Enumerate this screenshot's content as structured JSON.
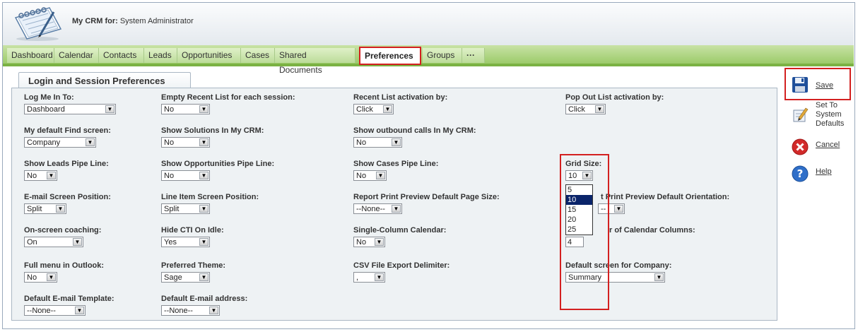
{
  "header": {
    "title_bold": "My CRM for:",
    "title_user": "System Administrator"
  },
  "tabs": [
    {
      "label": "Dashboard"
    },
    {
      "label": "Calendar"
    },
    {
      "label": "Contacts"
    },
    {
      "label": "Leads"
    },
    {
      "label": "Opportunities"
    },
    {
      "label": "Cases"
    },
    {
      "label": "Shared Documents"
    },
    {
      "label": "Preferences"
    },
    {
      "label": "Groups"
    },
    {
      "label": "···"
    }
  ],
  "section": {
    "title": "Login and Session Preferences"
  },
  "fields": {
    "log_me_in_to": {
      "label": "Log Me In To:",
      "value": "Dashboard"
    },
    "empty_recent": {
      "label": "Empty Recent List for each session:",
      "value": "No"
    },
    "recent_activation": {
      "label": "Recent List activation by:",
      "value": "Click"
    },
    "popout_activation": {
      "label": "Pop Out List activation by:",
      "value": "Click"
    },
    "default_find": {
      "label": "My default Find screen:",
      "value": "Company"
    },
    "show_solutions": {
      "label": "Show Solutions In My CRM:",
      "value": "No"
    },
    "show_outbound": {
      "label": "Show outbound calls In My CRM:",
      "value": "No"
    },
    "leads_pipe": {
      "label": "Show Leads Pipe Line:",
      "value": "No"
    },
    "opps_pipe": {
      "label": "Show Opportunities Pipe Line:",
      "value": "No"
    },
    "cases_pipe": {
      "label": "Show Cases Pipe Line:",
      "value": "No"
    },
    "grid_size": {
      "label": "Grid Size:",
      "value": "10"
    },
    "email_screen_pos": {
      "label": "E-mail Screen Position:",
      "value": "Split"
    },
    "line_item_pos": {
      "label": "Line Item Screen Position:",
      "value": "Split"
    },
    "report_page_size": {
      "label": "Report Print Preview Default Page Size:",
      "value": "--None--"
    },
    "report_orientation": {
      "label": "t Print Preview Default Orientation:",
      "value": "--"
    },
    "onscreen_coaching": {
      "label": "On-screen coaching:",
      "value": "On"
    },
    "hide_cti": {
      "label": "Hide CTI On Idle:",
      "value": "Yes"
    },
    "single_col_cal": {
      "label": "Single-Column Calendar:",
      "value": "No"
    },
    "num_cal_cols": {
      "label": "r of Calendar Columns:",
      "value": "4"
    },
    "full_menu_outlook": {
      "label": "Full menu in Outlook:",
      "value": "No"
    },
    "preferred_theme": {
      "label": "Preferred Theme:",
      "value": "Sage"
    },
    "csv_delimiter": {
      "label": "CSV File Export Delimiter:",
      "value": ","
    },
    "default_company_screen": {
      "label": "Default screen for Company:",
      "value": "Summary"
    },
    "default_email_template": {
      "label": "Default E-mail Template:",
      "value": "--None--"
    },
    "default_email_address": {
      "label": "Default E-mail address:",
      "value": "--None--"
    }
  },
  "grid_size_options": [
    "5",
    "10",
    "15",
    "20",
    "25"
  ],
  "actions": {
    "save": "Save",
    "set_defaults_1": "Set To",
    "set_defaults_2": "System",
    "set_defaults_3": "Defaults",
    "cancel": "Cancel",
    "help": "Help"
  },
  "colors": {
    "accent_green": "#9ccb6a",
    "highlight_red": "#d32020",
    "selection_blue": "#0a246a"
  }
}
